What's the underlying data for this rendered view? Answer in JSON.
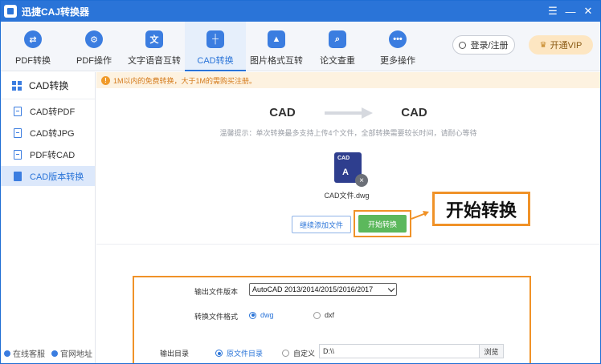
{
  "window": {
    "title": "迅捷CAJ转换器",
    "controls": [
      "☰",
      "—",
      "✕"
    ]
  },
  "toolbar": {
    "items": [
      {
        "label": "PDF转换",
        "icon": "swap-icon"
      },
      {
        "label": "PDF操作",
        "icon": "gear-icon"
      },
      {
        "label": "文字语音互转",
        "icon": "speech-icon"
      },
      {
        "label": "CAD转换",
        "icon": "cad-icon"
      },
      {
        "label": "图片格式互转",
        "icon": "image-icon"
      },
      {
        "label": "论文查重",
        "icon": "magnifier-icon"
      },
      {
        "label": "更多操作",
        "icon": "more-icon"
      }
    ],
    "active": "CAD转换",
    "login_label": "登录/注册",
    "vip_label": "开通VIP"
  },
  "sidebar": {
    "header": "CAD转换",
    "items": [
      {
        "label": "CAD转PDF"
      },
      {
        "label": "CAD转JPG"
      },
      {
        "label": "PDF转CAD"
      },
      {
        "label": "CAD版本转换"
      }
    ],
    "active": "CAD版本转换",
    "footer": {
      "service": "在线客服",
      "website": "官网地址"
    }
  },
  "main": {
    "notice": "1M以内的免费转换，大于1M的需购买注册。",
    "source_format": "CAD",
    "target_format": "CAD",
    "tip": "温馨提示：单次转换最多支持上传4个文件，全部转换需要较长时间，请耐心等待",
    "file": {
      "thumb_top": "CAD",
      "thumb_glyph": "A",
      "name": "CAD文件.dwg",
      "remove": "×"
    },
    "add_button": "继续添加文件",
    "start_button": "开始转换",
    "callout": "开始转换",
    "settings": {
      "version_label": "输出文件版本",
      "version_value": "AutoCAD 2013/2014/2015/2016/2017",
      "format_label": "转换文件格式",
      "format_options": [
        "dwg",
        "dxf"
      ],
      "format_selected": "dwg",
      "output_label": "输出目录",
      "output_options": [
        "原文件目录",
        "自定义"
      ],
      "output_selected": "原文件目录",
      "path_value": "D:\\\\",
      "browse_label": "浏览"
    }
  },
  "colors": {
    "brand": "#2a74d8",
    "highlight": "#f09228",
    "start": "#5cb85c",
    "notice_text": "#d47a1a"
  }
}
